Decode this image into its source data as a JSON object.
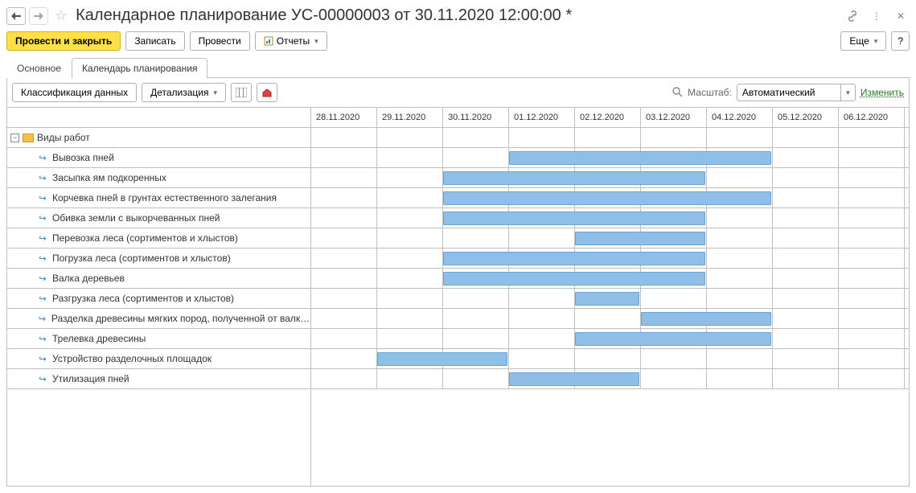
{
  "header": {
    "title": "Календарное планирование УС-00000003 от 30.11.2020 12:00:00 *"
  },
  "toolbar": {
    "post_and_close": "Провести и закрыть",
    "save": "Записать",
    "post": "Провести",
    "reports": "Отчеты",
    "more": "Еще",
    "help": "?"
  },
  "tabs": {
    "main": "Основное",
    "calendar": "Календарь планирования"
  },
  "subbar": {
    "classify": "Классификация данных",
    "detail": "Детализация",
    "scale_label": "Масштаб:",
    "scale_value": "Автоматический",
    "edit": "Изменить"
  },
  "dates": [
    "28.11.2020",
    "29.11.2020",
    "30.11.2020",
    "01.12.2020",
    "02.12.2020",
    "03.12.2020",
    "04.12.2020",
    "05.12.2020",
    "06.12.2020"
  ],
  "root_label": "Виды работ",
  "tasks": [
    {
      "label": "Вывозка пней",
      "start": 3,
      "span": 4
    },
    {
      "label": "Засыпка ям подкоренных",
      "start": 2,
      "span": 4
    },
    {
      "label": "Корчевка пней в грунтах естественного залегания",
      "start": 2,
      "span": 5
    },
    {
      "label": "Обивка земли с выкорчеванных пней",
      "start": 2,
      "span": 4
    },
    {
      "label": "Перевозка леса (сортиментов и хлыстов)",
      "start": 4,
      "span": 2
    },
    {
      "label": "Погрузка леса (сортиментов и хлыстов)",
      "start": 2,
      "span": 4
    },
    {
      "label": "Валка деревьев",
      "start": 2,
      "span": 4
    },
    {
      "label": "Разгрузка леса (сортиментов и хлыстов)",
      "start": 4,
      "span": 1
    },
    {
      "label": "Разделка древесины мягких пород, полученной от валки леса",
      "start": 5,
      "span": 2
    },
    {
      "label": "Трелевка древесины",
      "start": 4,
      "span": 3
    },
    {
      "label": "Устройство разделочных площадок",
      "start": 1,
      "span": 2
    },
    {
      "label": "Утилизация пней",
      "start": 3,
      "span": 2
    }
  ],
  "chart_data": {
    "type": "gantt",
    "x_unit": "day",
    "x_categories": [
      "28.11.2020",
      "29.11.2020",
      "30.11.2020",
      "01.12.2020",
      "02.12.2020",
      "03.12.2020",
      "04.12.2020",
      "05.12.2020",
      "06.12.2020"
    ],
    "tasks": [
      {
        "name": "Вывозка пней",
        "start": "01.12.2020",
        "end": "04.12.2020"
      },
      {
        "name": "Засыпка ям подкоренных",
        "start": "30.11.2020",
        "end": "03.12.2020"
      },
      {
        "name": "Корчевка пней в грунтах естественного залегания",
        "start": "30.11.2020",
        "end": "04.12.2020"
      },
      {
        "name": "Обивка земли с выкорчеванных пней",
        "start": "30.11.2020",
        "end": "03.12.2020"
      },
      {
        "name": "Перевозка леса (сортиментов и хлыстов)",
        "start": "02.12.2020",
        "end": "03.12.2020"
      },
      {
        "name": "Погрузка леса (сортиментов и хлыстов)",
        "start": "30.11.2020",
        "end": "03.12.2020"
      },
      {
        "name": "Валка деревьев",
        "start": "30.11.2020",
        "end": "03.12.2020"
      },
      {
        "name": "Разгрузка леса (сортиментов и хлыстов)",
        "start": "02.12.2020",
        "end": "02.12.2020"
      },
      {
        "name": "Разделка древесины мягких пород, полученной от валки леса",
        "start": "03.12.2020",
        "end": "04.12.2020"
      },
      {
        "name": "Трелевка древесины",
        "start": "02.12.2020",
        "end": "04.12.2020"
      },
      {
        "name": "Устройство разделочных площадок",
        "start": "29.11.2020",
        "end": "30.11.2020"
      },
      {
        "name": "Утилизация пней",
        "start": "01.12.2020",
        "end": "02.12.2020"
      }
    ]
  },
  "colors": {
    "bar_fill": "#8fbfe6",
    "bar_border": "#6aa4d4",
    "primary_btn": "#ffe04a"
  }
}
